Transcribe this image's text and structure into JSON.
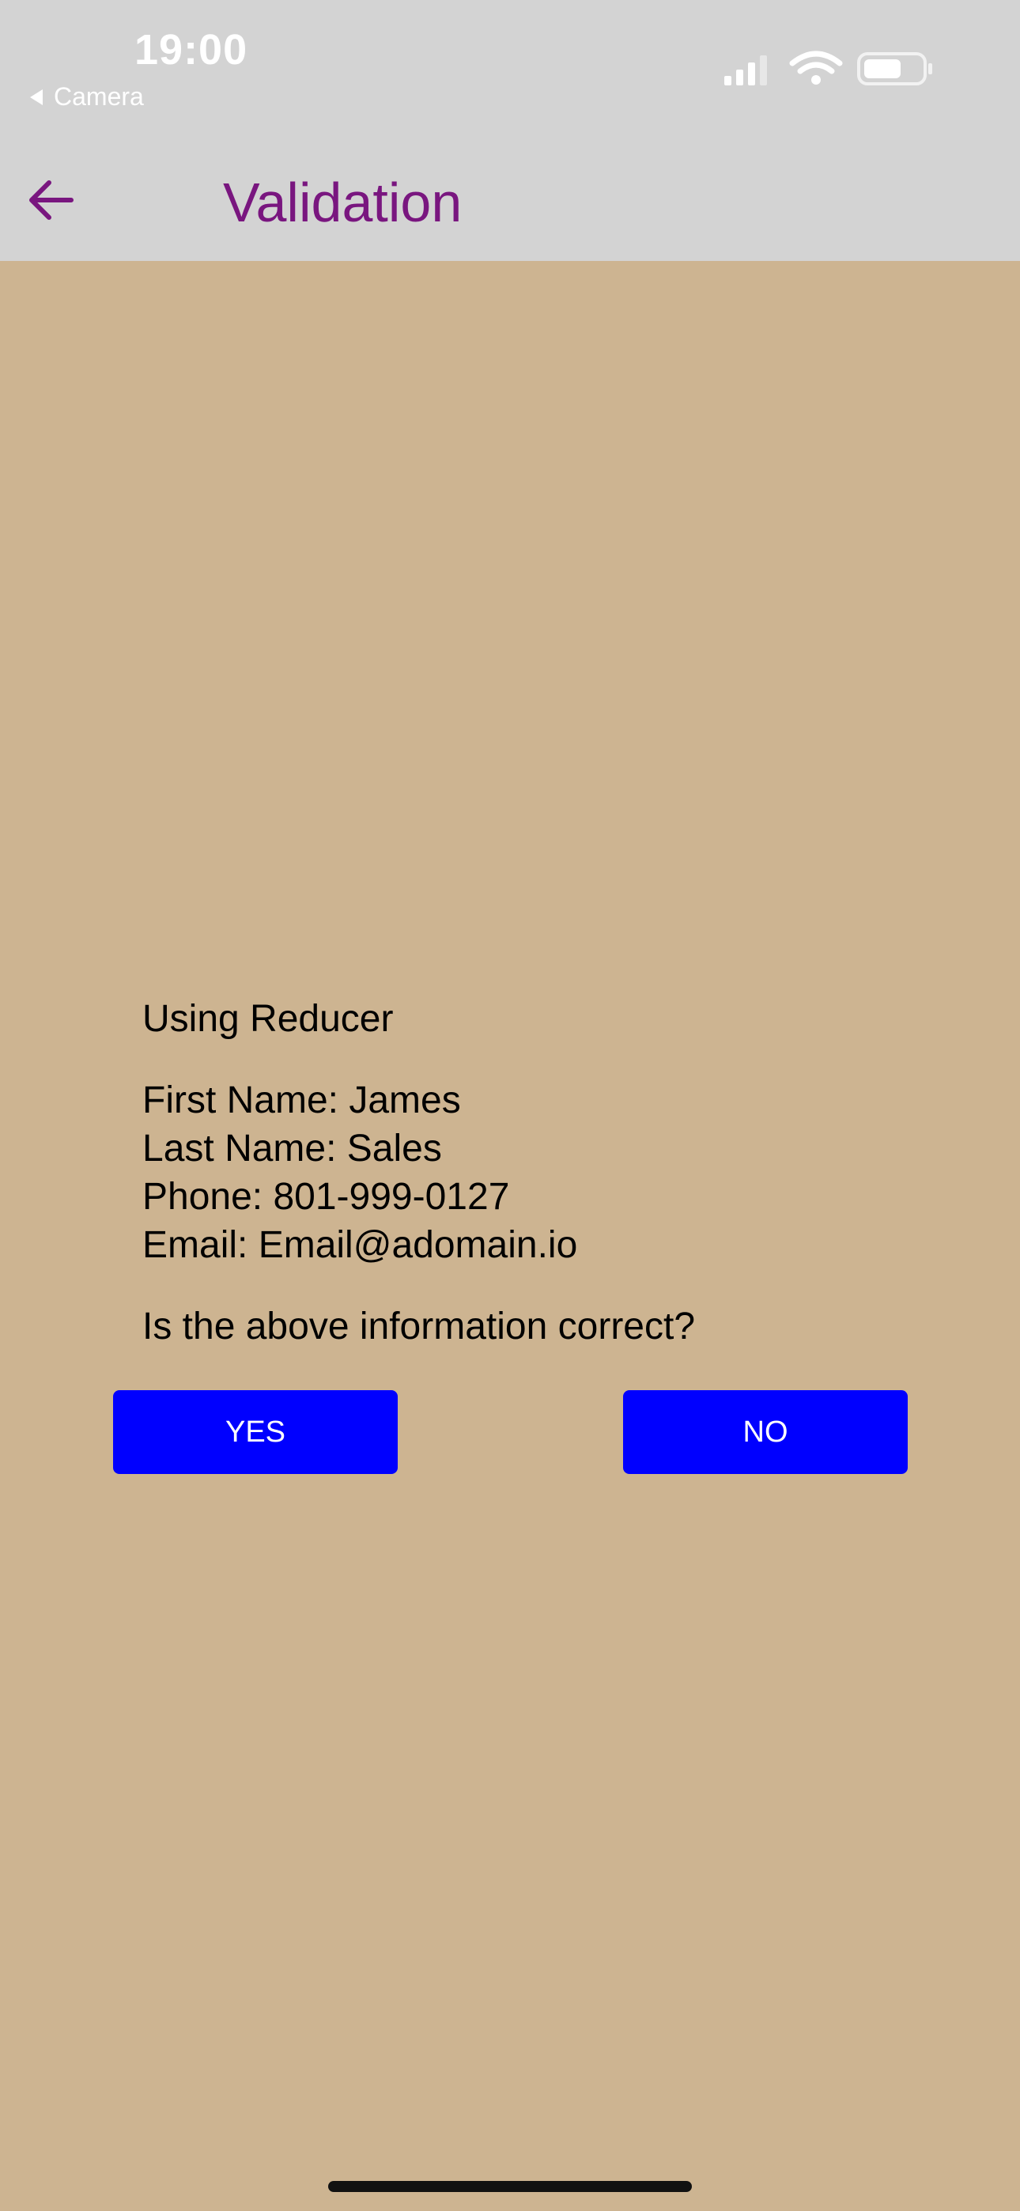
{
  "status_bar": {
    "time": "19:00",
    "back_app_label": "Camera"
  },
  "nav": {
    "title": "Validation",
    "title_color": "#79167f"
  },
  "content": {
    "heading": "Using Reducer",
    "info_lines": [
      "First Name:  James",
      "Last Name: Sales",
      "Phone:  801-999-0127",
      "Email: Email@adomain.io"
    ],
    "question": "Is the above information correct?"
  },
  "buttons": {
    "yes_label": "YES",
    "no_label": "NO",
    "color": "#0000ff"
  },
  "colors": {
    "header_bg": "#d3d3d3",
    "page_bg": "#cdb491"
  },
  "icons": {
    "back": "arrow-left-icon",
    "signal": "cellular-signal-icon",
    "wifi": "wifi-icon",
    "battery": "battery-icon"
  }
}
